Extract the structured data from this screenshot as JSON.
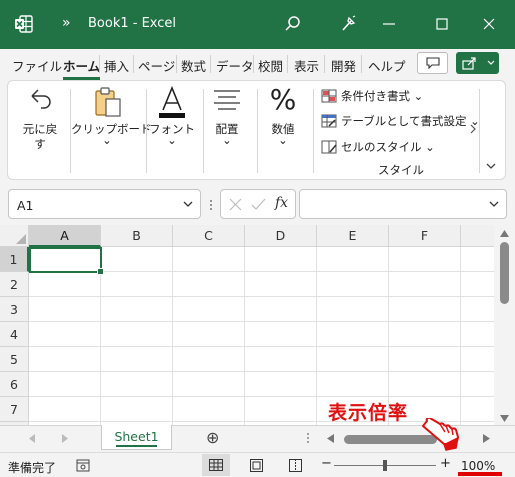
{
  "window": {
    "title": "Book1  -  Excel",
    "chevron": "»",
    "colors": {
      "brand": "#217346",
      "annotation": "#e01010"
    }
  },
  "ribbon_tabs": [
    {
      "label": "ファイル",
      "active": false
    },
    {
      "label": "ホーム",
      "active": true
    },
    {
      "label": "挿入",
      "active": false
    },
    {
      "label": "ページ",
      "active": false
    },
    {
      "label": "数式",
      "active": false
    },
    {
      "label": "データ",
      "active": false
    },
    {
      "label": "校閲",
      "active": false
    },
    {
      "label": "表示",
      "active": false
    },
    {
      "label": "開発",
      "active": false
    },
    {
      "label": "ヘルプ",
      "active": false
    }
  ],
  "ribbon": {
    "undo": {
      "line1": "元に戻",
      "line2": "す",
      "caret": "⌄"
    },
    "clipboard": {
      "label": "クリップボード",
      "caret": "⌄"
    },
    "font": {
      "label": "フォント",
      "caret": "⌄"
    },
    "alignment": {
      "label": "配置",
      "caret": "⌄"
    },
    "number": {
      "label": "数値",
      "caret": "⌄",
      "glyph": "%"
    },
    "styles": {
      "conditional": "条件付き書式 ⌄",
      "table": "テーブルとして書式設定 ⌄",
      "cell": "セルのスタイル ⌄",
      "group_label": "スタイル"
    }
  },
  "formula_bar": {
    "name_box": "A1",
    "fx": "fx",
    "formula": ""
  },
  "grid": {
    "columns": [
      "A",
      "B",
      "C",
      "D",
      "E",
      "F"
    ],
    "rows": [
      "1",
      "2",
      "3",
      "4",
      "5",
      "6",
      "7"
    ],
    "active_cell": "A1"
  },
  "sheets": {
    "tabs": [
      "Sheet1"
    ],
    "add_glyph": "⊕"
  },
  "status": {
    "ready": "準備完了",
    "zoom_minus": "−",
    "zoom_plus": "+",
    "zoom": "100%",
    "zoom_slider_fraction": 0.5
  },
  "annotation": {
    "text": "表示倍率",
    "icon": "pointing-hand-icon"
  }
}
